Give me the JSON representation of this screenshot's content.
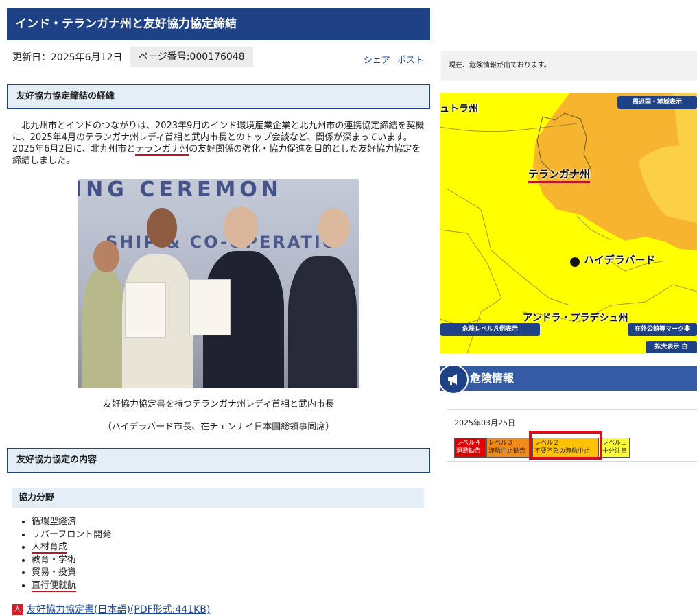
{
  "page": {
    "title": "インド・テランガナ州と友好協力協定締結",
    "updated": "更新日：2025年6月12日",
    "page_number": "ページ番号:000176048",
    "share": "シェア",
    "post": "ポスト"
  },
  "section1": {
    "heading": "友好協力協定締結の経緯",
    "intro_part1": "北九州市とインドのつながりは、2023年9月のインド環境産業企業と北九州市の連携協定締結を契機に、2025年4月のテランガナ州レディ首相と武内市長とのトップ会談など、関係が深まっています。2025年6月2日に、北九州市と",
    "intro_highlight": "テランガナ州",
    "intro_part2": "の友好関係の強化・協力促進を目的とした友好協力協定を締結しました。"
  },
  "photo": {
    "banner_line1": "ING CEREMON",
    "banner_line2": "SHIP & CO-OPERATIO",
    "caption1": "友好協力協定書を持つテランガナ州レディ首相と武内市長",
    "caption2": "（ハイデラバード市長、在チェンナイ日本国総領事同席）"
  },
  "section2": {
    "heading": "友好協力協定の内容",
    "field_heading": "協力分野",
    "fields": [
      "循環型経済",
      "リバーフロント開発",
      "人材育成",
      "教育・学術",
      "貿易・投資",
      "直行便就航"
    ]
  },
  "pdf": {
    "icon": "pdf-icon",
    "label": "友好協力協定書(日本語)(PDF形式:441KB)"
  },
  "right": {
    "alert": "現在、危険情報が出ております。",
    "map": {
      "label_north": "ュトラ州",
      "label_telangana": "テランガナ州",
      "label_hyderabad": "ハイデラバード",
      "label_andhra": "アンドラ・プラデシュ州",
      "btn_neighbors": "周辺国・地域表示",
      "btn_legend": "危険レベル凡例表示",
      "btn_embassy": "在外公館等マーク非",
      "btn_zoom": "拡大表示 白",
      "colors": {
        "level1": "#ffff00",
        "level2": "#f7b52f",
        "level2_light": "#fbd046"
      }
    },
    "danger_title": "危険情報",
    "danger_icon": "megaphone-icon",
    "levels": {
      "date": "2025年03月25日",
      "lv4_title": "レベル４",
      "lv4_text": "退避勧告",
      "lv3_title": "レベル３",
      "lv3_text": "渡航中止勧告",
      "lv2_title": "レベル２",
      "lv2_text": "不要不急の渡航中止",
      "lv1_title": "レベル１",
      "lv1_text": "十分注意"
    }
  }
}
